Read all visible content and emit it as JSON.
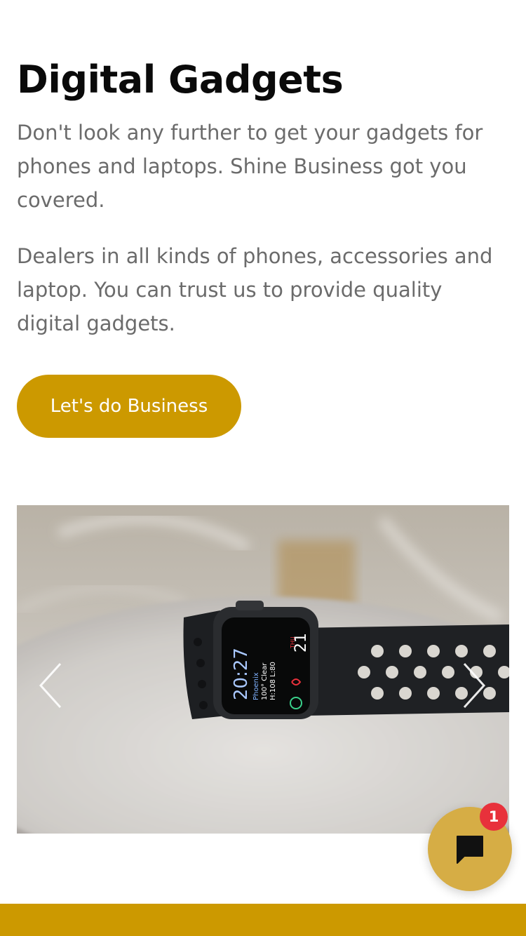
{
  "hero": {
    "title": "Digital Gadgets",
    "paragraph_1": "Don't look any further to get your gadgets for phones and laptops. Shine Business got you covered.",
    "paragraph_2": "Dealers in all kinds of phones, accessories and laptop. You can trust us to provide quality digital gadgets.",
    "cta_label": "Let's do Business"
  },
  "carousel": {
    "watch_time": "20:27",
    "watch_date_day": "THU",
    "watch_date_num": "21",
    "watch_city": "Phoenix",
    "watch_weather": "100° Clear",
    "watch_hilo": "H:108 L:80",
    "watch_ring": "83"
  },
  "chat": {
    "badge_count": "1"
  },
  "colors": {
    "accent": "#cc9900",
    "fab": "#d6ad45",
    "badge": "#e8313b",
    "text_muted": "#6b6b6b",
    "heading": "#0a0a0a"
  },
  "icons": {
    "prev": "chevron-left-icon",
    "next": "chevron-right-icon",
    "chat": "chat-bubble-icon"
  }
}
